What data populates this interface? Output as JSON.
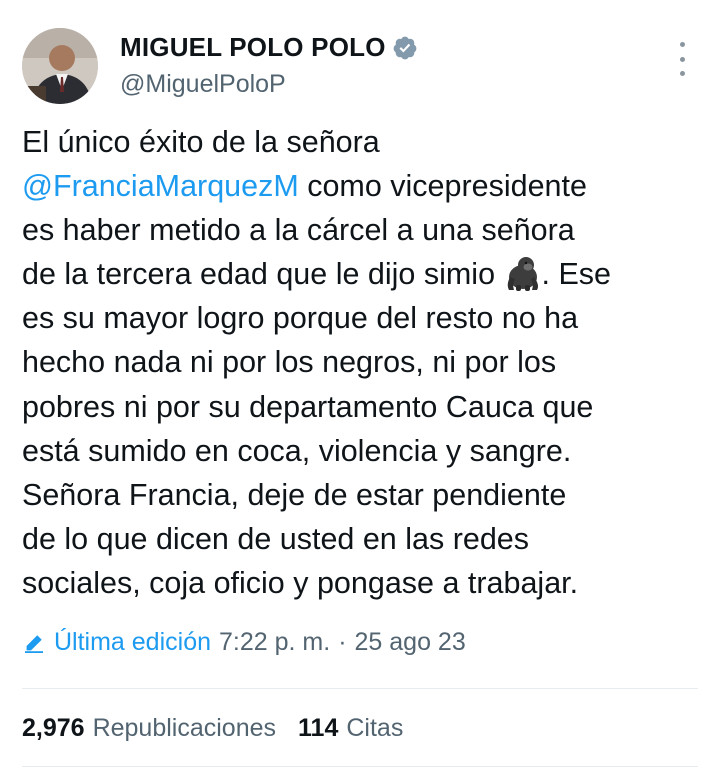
{
  "author": {
    "display_name": "MIGUEL POLO POLO",
    "handle": "@MiguelPoloP",
    "avatar_icon": "profile-photo",
    "verified_icon": "verified-badge-icon"
  },
  "tweet": {
    "lines": [
      [
        "El único éxito de la señora"
      ],
      [
        "@FranciaMarquezM",
        " como vicepresidente"
      ],
      [
        "es haber metido a la cárcel a una señora"
      ],
      [
        "de la tercera edad que le dijo simio ",
        "🦍",
        ". Ese"
      ],
      [
        "es su mayor logro porque del resto no ha"
      ],
      [
        "hecho nada ni por los negros, ni por los"
      ],
      [
        "pobres ni por su departamento Cauca que"
      ],
      [
        "está sumido en coca, violencia y sangre."
      ],
      [
        "Señora Francia, deje de estar pendiente"
      ],
      [
        "de lo que dicen de usted en las redes"
      ],
      [
        "sociales, coja oficio y pongase a trabajar."
      ]
    ]
  },
  "meta": {
    "edited_label": "Última edición",
    "time": "7:22 p. m.",
    "separator": "·",
    "date": "25 ago 23"
  },
  "stats": {
    "reposts_count": "2,976",
    "reposts_label": "Republicaciones",
    "quotes_count": "114",
    "quotes_label": "Citas"
  },
  "colors": {
    "accent": "#1d9bf0",
    "secondary_text": "#536471"
  }
}
